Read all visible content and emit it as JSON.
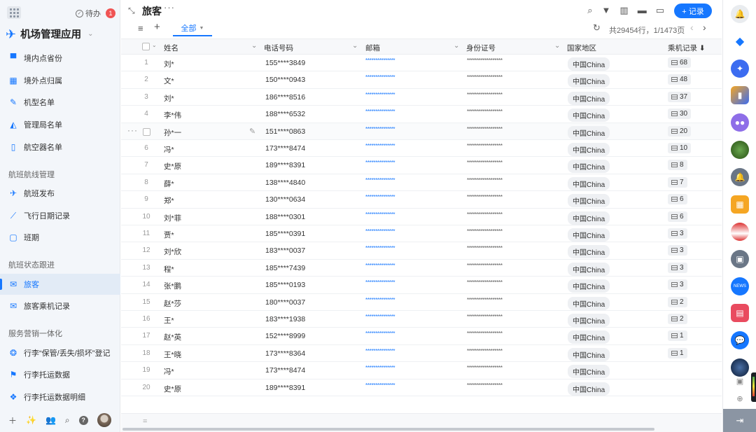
{
  "sidebar": {
    "todo_label": "待办",
    "todo_count": "1",
    "app_name": "机场管理应用",
    "menu": [
      {
        "label": "境内点省份",
        "icon": "printer-icon"
      },
      {
        "label": "境外点归属",
        "icon": "table-icon"
      },
      {
        "label": "机型名单",
        "icon": "magic-wand-icon"
      },
      {
        "label": "管理局名单",
        "icon": "chart-icon"
      },
      {
        "label": "航空器名单",
        "icon": "tablet-icon"
      }
    ],
    "section1": "航班航线管理",
    "menu2": [
      {
        "label": "航班发布",
        "icon": "plane-icon"
      },
      {
        "label": "飞行日期记录",
        "icon": "line-chart-icon"
      },
      {
        "label": "班期",
        "icon": "calendar-icon"
      }
    ],
    "section2": "航班状态跟进",
    "menu3": [
      {
        "label": "旅客",
        "icon": "mail-icon",
        "active": true
      },
      {
        "label": "旅客乘机记录",
        "icon": "mail-check-icon"
      }
    ],
    "section3": "服务营销一体化",
    "menu4": [
      {
        "label": "行李“保管/丢失/损坏”登记",
        "icon": "brain-icon"
      },
      {
        "label": "行李托运数据",
        "icon": "signpost-icon"
      },
      {
        "label": "行李托运数据明细",
        "icon": "network-icon"
      }
    ]
  },
  "header": {
    "title": "旅客",
    "record_button": "+ 记录",
    "tab_all": "全部",
    "count_text": "共29454行，1/1473页"
  },
  "columns": [
    "姓名",
    "电话号码",
    "邮箱",
    "身份证号",
    "国家地区",
    "乘机记录 ⬇"
  ],
  "rows": [
    {
      "num": "1",
      "name": "刘*",
      "phone": "155****3849",
      "email": "***************",
      "id": "******************",
      "country": "中国China",
      "records": "68"
    },
    {
      "num": "2",
      "name": "文*",
      "phone": "150****0943",
      "email": "***************",
      "id": "******************",
      "country": "中国China",
      "records": "48"
    },
    {
      "num": "3",
      "name": "刘*",
      "phone": "186****8516",
      "email": "***************",
      "id": "******************",
      "country": "中国China",
      "records": "37"
    },
    {
      "num": "4",
      "name": "李*伟",
      "phone": "188****6532",
      "email": "***************",
      "id": "******************",
      "country": "中国China",
      "records": "30"
    },
    {
      "num": "",
      "name": "孙*一",
      "phone": "151****0863",
      "email": "***************",
      "id": "******************",
      "country": "中国China",
      "records": "20"
    },
    {
      "num": "6",
      "name": "冯*",
      "phone": "173****8474",
      "email": "***************",
      "id": "******************",
      "country": "中国China",
      "records": "10"
    },
    {
      "num": "7",
      "name": "史*原",
      "phone": "189****8391",
      "email": "***************",
      "id": "******************",
      "country": "中国China",
      "records": "8"
    },
    {
      "num": "8",
      "name": "薛*",
      "phone": "138****4840",
      "email": "***************",
      "id": "******************",
      "country": "中国China",
      "records": "7"
    },
    {
      "num": "9",
      "name": "郑*",
      "phone": "130****0634",
      "email": "***************",
      "id": "******************",
      "country": "中国China",
      "records": "6"
    },
    {
      "num": "10",
      "name": "刘*菲",
      "phone": "188****0301",
      "email": "***************",
      "id": "******************",
      "country": "中国China",
      "records": "6"
    },
    {
      "num": "11",
      "name": "贾*",
      "phone": "185****0391",
      "email": "***************",
      "id": "******************",
      "country": "中国China",
      "records": "3"
    },
    {
      "num": "12",
      "name": "刘*欣",
      "phone": "183****0037",
      "email": "***************",
      "id": "******************",
      "country": "中国China",
      "records": "3"
    },
    {
      "num": "13",
      "name": "程*",
      "phone": "185****7439",
      "email": "***************",
      "id": "******************",
      "country": "中国China",
      "records": "3"
    },
    {
      "num": "14",
      "name": "张*鹏",
      "phone": "185****0193",
      "email": "***************",
      "id": "******************",
      "country": "中国China",
      "records": "3"
    },
    {
      "num": "15",
      "name": "赵*莎",
      "phone": "180****0037",
      "email": "***************",
      "id": "******************",
      "country": "中国China",
      "records": "2"
    },
    {
      "num": "16",
      "name": "王*",
      "phone": "183****1938",
      "email": "***************",
      "id": "******************",
      "country": "中国China",
      "records": "2"
    },
    {
      "num": "17",
      "name": "赵*英",
      "phone": "152****8999",
      "email": "***************",
      "id": "******************",
      "country": "中国China",
      "records": "1"
    },
    {
      "num": "18",
      "name": "王*晓",
      "phone": "173****8364",
      "email": "***************",
      "id": "******************",
      "country": "中国China",
      "records": "1"
    },
    {
      "num": "19",
      "name": "冯*",
      "phone": "173****8474",
      "email": "***************",
      "id": "******************",
      "country": "中国China",
      "records": ""
    },
    {
      "num": "20",
      "name": "史*原",
      "phone": "189****8391",
      "email": "***************",
      "id": "******************",
      "country": "中国China",
      "records": ""
    }
  ],
  "footer": {
    "eq": "="
  },
  "rightbar": {
    "news_label": "NEWS"
  },
  "colors": {
    "accent": "#1677ff",
    "sidebar_bg": "#f3f6fa",
    "active_bg": "#e2ebf6"
  }
}
